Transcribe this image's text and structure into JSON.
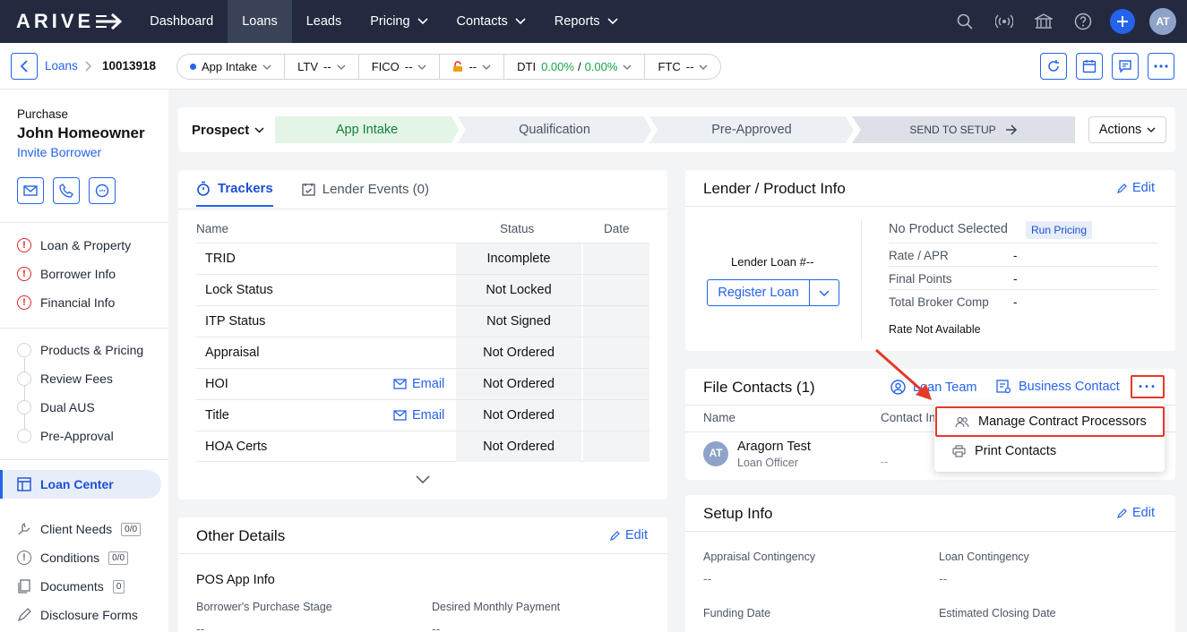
{
  "nav": {
    "logo": "ARIVE",
    "items": [
      "Dashboard",
      "Loans",
      "Leads",
      "Pricing",
      "Contacts",
      "Reports"
    ],
    "user_initials": "AT"
  },
  "subbar": {
    "breadcrumb_link": "Loans",
    "loan_id": "10013918",
    "stage": "App Intake",
    "ltv_label": "LTV",
    "ltv_value": "--",
    "fico_label": "FICO",
    "fico_value": "--",
    "lock_value": "--",
    "dti_label": "DTI",
    "dti_front": "0.00%",
    "dti_sep": "/",
    "dti_back": "0.00%",
    "ftc_label": "FTC",
    "ftc_value": "--"
  },
  "sidebar": {
    "loan_type": "Purchase",
    "borrower_name": "John Homeowner",
    "invite_label": "Invite Borrower",
    "warn_items": [
      "Loan & Property",
      "Borrower Info",
      "Financial Info"
    ],
    "steps": [
      "Products & Pricing",
      "Review Fees",
      "Dual AUS",
      "Pre-Approval"
    ],
    "active_item": "Loan Center",
    "client_needs": "Client Needs",
    "client_needs_badge": "0/0",
    "conditions": "Conditions",
    "conditions_badge": "0/0",
    "documents": "Documents",
    "documents_badge": "0",
    "disclosure": "Disclosure Forms"
  },
  "stagebar": {
    "status": "Prospect",
    "stages": [
      "App Intake",
      "Qualification",
      "Pre-Approved"
    ],
    "send_label": "SEND TO SETUP",
    "actions_label": "Actions"
  },
  "trackers": {
    "tab_trackers": "Trackers",
    "tab_events": "Lender Events (0)",
    "col_name": "Name",
    "col_status": "Status",
    "col_date": "Date",
    "email_label": "Email",
    "rows": [
      {
        "name": "TRID",
        "status": "Incomplete"
      },
      {
        "name": "Lock Status",
        "status": "Not Locked"
      },
      {
        "name": "ITP Status",
        "status": "Not Signed"
      },
      {
        "name": "Appraisal",
        "status": "Not Ordered"
      },
      {
        "name": "HOI",
        "status": "Not Ordered"
      },
      {
        "name": "Title",
        "status": "Not Ordered"
      },
      {
        "name": "HOA Certs",
        "status": "Not Ordered"
      }
    ]
  },
  "lender": {
    "title": "Lender / Product Info",
    "edit": "Edit",
    "loan_num_label": "Lender Loan #--",
    "register_label": "Register Loan",
    "no_product": "No Product Selected",
    "run_pricing": "Run Pricing",
    "rate_apr_label": "Rate / APR",
    "rate_apr_value": "-",
    "final_points_label": "Final Points",
    "final_points_value": "-",
    "broker_comp_label": "Total Broker Comp",
    "broker_comp_value": "-",
    "rate_na": "Rate Not Available"
  },
  "contacts": {
    "title": "File Contacts (1)",
    "loan_team": "Loan Team",
    "business_contact": "Business Contact",
    "more": "···",
    "col_name": "Name",
    "col_contact": "Contact In",
    "contact_name": "Aragorn Test",
    "contact_role": "Loan Officer",
    "contact_initials": "AT",
    "contact_dash": "--",
    "menu": [
      "Manage Contract Processors",
      "Print Contacts"
    ]
  },
  "other": {
    "title": "Other Details",
    "edit": "Edit",
    "subhead": "POS App Info",
    "f1_label": "Borrower's Purchase Stage",
    "f1_value": "--",
    "f2_label": "Desired Monthly Payment",
    "f2_value": "--"
  },
  "setup": {
    "title": "Setup Info",
    "edit": "Edit",
    "f1_label": "Appraisal Contingency",
    "f1_value": "--",
    "f2_label": "Loan Contingency",
    "f2_value": "--",
    "f3_label": "Funding Date",
    "f4_label": "Estimated Closing Date"
  },
  "colors": {
    "primary": "#2563eb",
    "nav_bg": "#23293f",
    "highlight": "#e53929",
    "success": "#16a34a",
    "warning": "#dc2626"
  },
  "icons": [
    "search-icon",
    "broadcast-icon",
    "bank-icon",
    "help-icon",
    "plus-icon",
    "mail-icon",
    "phone-icon",
    "chat-icon",
    "calendar-icon",
    "refresh-icon",
    "lock-icon",
    "stopwatch-icon",
    "user-circle-icon",
    "address-card-icon",
    "users-icon",
    "printer-icon",
    "pencil-icon",
    "arrow-icon"
  ]
}
